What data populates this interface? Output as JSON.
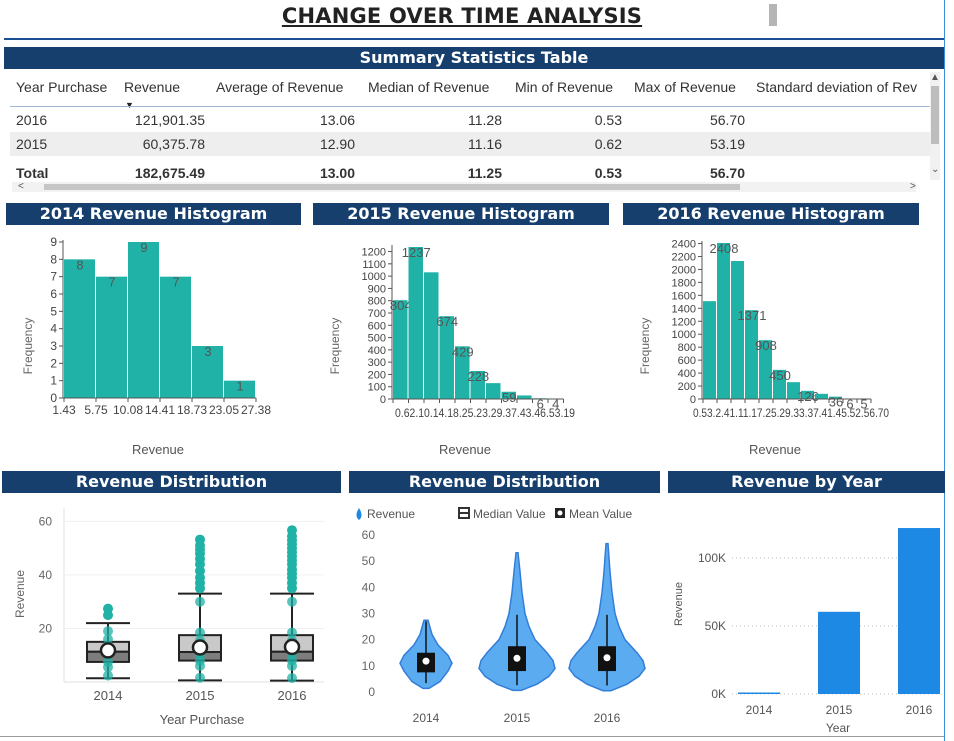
{
  "page": {
    "title": "CHANGE OVER TIME ANALYSIS",
    "summary_header": "Summary Statistics Table"
  },
  "table": {
    "columns": [
      "Year Purchase",
      "Revenue",
      "Average of Revenue",
      "Median of Revenue",
      "Min of Revenue",
      "Max of Revenue",
      "Standard deviation of Rev"
    ],
    "rows": [
      [
        "2016",
        "121,901.35",
        "13.06",
        "11.28",
        "0.53",
        "56.70",
        ""
      ],
      [
        "2015",
        "60,375.78",
        "12.90",
        "11.16",
        "0.62",
        "53.19",
        ""
      ]
    ],
    "total": [
      "Total",
      "182,675.49",
      "13.00",
      "11.25",
      "0.53",
      "56.70",
      ""
    ],
    "sort_indicator": "▼",
    "scroll_up": "▲",
    "scroll_down": "⌄",
    "scroll_left": "<",
    "scroll_right": ">"
  },
  "colors": {
    "header_bg": "#163f6e",
    "teal": "#20b2a6",
    "blue": "#1e88e5",
    "violin_blue": "#4aa3ef"
  },
  "chart_data": [
    {
      "type": "bar",
      "title": "2014 Revenue Histogram",
      "xlabel": "Revenue",
      "ylabel": "Frequency",
      "bin_edges": [
        "1.43",
        "5.75",
        "10.08",
        "14.41",
        "18.73",
        "23.05",
        "27.38"
      ],
      "values": [
        8,
        7,
        9,
        7,
        3,
        1
      ],
      "ylim": [
        0,
        9
      ],
      "yticks": [
        0,
        1,
        2,
        3,
        4,
        5,
        6,
        7,
        8,
        9
      ]
    },
    {
      "type": "bar",
      "title": "2015 Revenue Histogram",
      "xlabel": "Revenue",
      "ylabel": "Frequency",
      "values": [
        804,
        1237,
        1031,
        674,
        429,
        228,
        129,
        59,
        29,
        6,
        4
      ],
      "value_labels": [
        "804",
        "1237",
        "",
        "674",
        "429",
        "228",
        "",
        "59",
        "",
        "6",
        "4"
      ],
      "x_tick_text": "0.62.10.14.18.25.23.29.37.43.46.53.19",
      "ylim": [
        0,
        1237
      ],
      "yticks": [
        0,
        100,
        200,
        300,
        400,
        500,
        600,
        700,
        800,
        900,
        1000,
        1100,
        1200
      ]
    },
    {
      "type": "bar",
      "title": "2016 Revenue Histogram",
      "xlabel": "Revenue",
      "ylabel": "Frequency",
      "values": [
        1510,
        2408,
        2130,
        1371,
        908,
        450,
        260,
        126,
        80,
        36,
        6,
        5
      ],
      "value_labels": [
        "",
        "2408",
        "",
        "1371",
        "908",
        "450",
        "",
        "126",
        "",
        "36",
        "6",
        "5"
      ],
      "x_tick_text": "0.53.2.41.11.17.25.29.33.37.41.45.52.56.70",
      "ylim": [
        0,
        2408
      ],
      "yticks": [
        0,
        200,
        400,
        600,
        800,
        1000,
        1200,
        1400,
        1600,
        1800,
        2000,
        2200,
        2400
      ]
    },
    {
      "type": "scatter",
      "title": "Revenue Distribution",
      "xlabel": "Year Purchase",
      "ylabel": "Revenue",
      "categories": [
        "2014",
        "2015",
        "2016"
      ],
      "ylim": [
        0,
        65
      ],
      "yticks": [
        20,
        40,
        60
      ],
      "boxes": [
        {
          "min": 1.4,
          "q1": 7.5,
          "median": 11.3,
          "mean": 11.8,
          "q3": 15.0,
          "max": 22.0
        },
        {
          "min": 0.6,
          "q1": 8.0,
          "median": 11.2,
          "mean": 12.9,
          "q3": 17.5,
          "max": 33.0
        },
        {
          "min": 0.5,
          "q1": 8.0,
          "median": 11.3,
          "mean": 13.1,
          "q3": 17.5,
          "max": 33.0
        }
      ],
      "outliers": [
        [
          27.4,
          25.0
        ],
        [
          35.0,
          37.0,
          39.0,
          41.5,
          44.0,
          46.0,
          48.0,
          49.5,
          51.0,
          53.2
        ],
        [
          35.0,
          37.0,
          39.0,
          40.5,
          42.0,
          44.0,
          45.5,
          47.0,
          48.5,
          50.0,
          51.5,
          53.0,
          54.5,
          56.7
        ]
      ]
    },
    {
      "type": "area",
      "title": "Revenue Distribution",
      "categories": [
        "2014",
        "2015",
        "2016"
      ],
      "legend": [
        "Revenue",
        "Median Value",
        "Mean Value"
      ],
      "ylim": [
        0,
        60
      ],
      "yticks": [
        0,
        10,
        20,
        30,
        40,
        50,
        60
      ],
      "stats": [
        {
          "min": 1.4,
          "q1": 7.5,
          "median": 11.3,
          "mean": 11.8,
          "q3": 15.0,
          "max": 27.4
        },
        {
          "min": 0.6,
          "q1": 8.0,
          "median": 11.2,
          "mean": 12.9,
          "q3": 17.5,
          "max": 53.2
        },
        {
          "min": 0.5,
          "q1": 8.0,
          "median": 11.3,
          "mean": 13.1,
          "q3": 17.5,
          "max": 56.7
        }
      ]
    },
    {
      "type": "bar",
      "title": "Revenue by Year",
      "xlabel": "Year",
      "ylabel": "Revenue",
      "categories": [
        "2014",
        "2015",
        "2016"
      ],
      "values": [
        398,
        60375.78,
        121901.35
      ],
      "ylim": [
        0,
        130000
      ],
      "yticks": [
        "0K",
        "50K",
        "100K"
      ]
    }
  ]
}
